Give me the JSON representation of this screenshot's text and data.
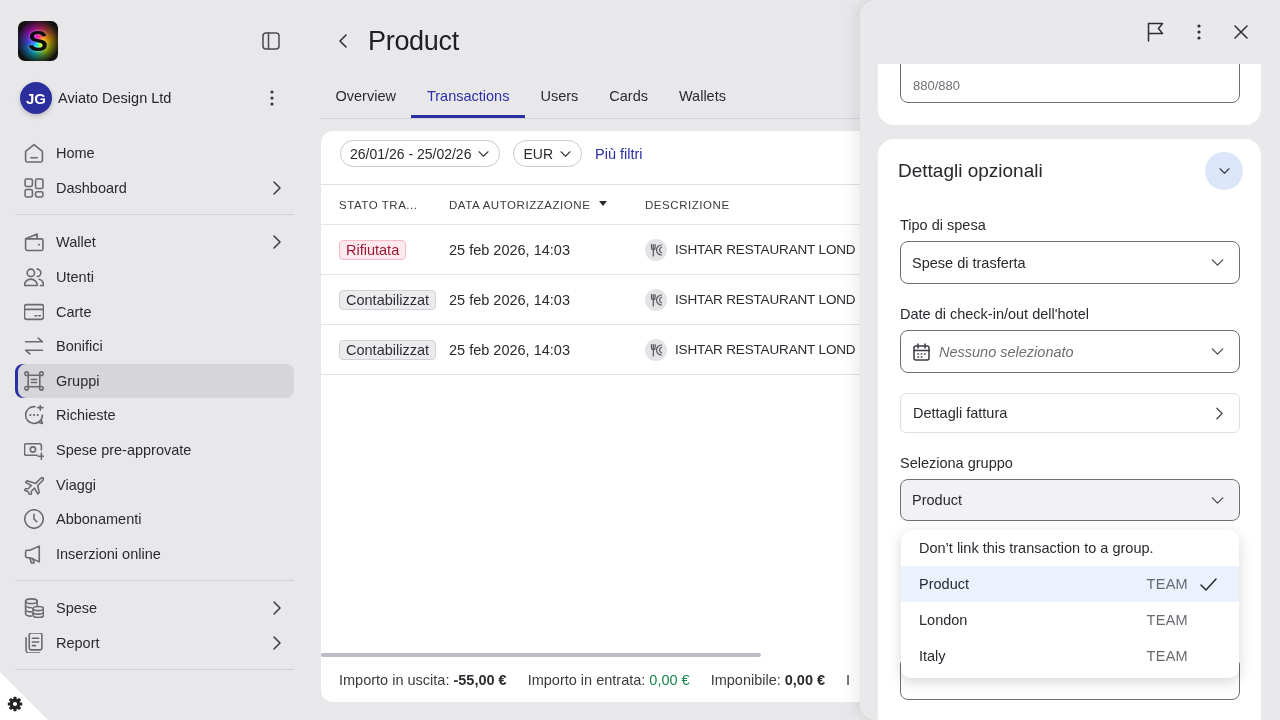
{
  "sidebar": {
    "logo": {
      "letter": "S"
    },
    "account": {
      "initials": "JG",
      "name": "Aviato Design Ltd"
    },
    "sections": [
      {
        "items": [
          {
            "label": "Home",
            "has_submenu": false,
            "selected": false
          },
          {
            "label": "Dashboard",
            "has_submenu": true,
            "selected": false
          }
        ]
      },
      {
        "items": [
          {
            "label": "Wallet",
            "has_submenu": true,
            "selected": false
          },
          {
            "label": "Utenti",
            "has_submenu": false,
            "selected": false
          },
          {
            "label": "Carte",
            "has_submenu": false,
            "selected": false
          },
          {
            "label": "Bonifici",
            "has_submenu": false,
            "selected": false
          },
          {
            "label": "Gruppi",
            "has_submenu": false,
            "selected": true
          },
          {
            "label": "Richieste",
            "has_submenu": false,
            "selected": false
          },
          {
            "label": "Spese pre-approvate",
            "has_submenu": false,
            "selected": false
          },
          {
            "label": "Viaggi",
            "has_submenu": false,
            "selected": false
          },
          {
            "label": "Abbonamenti",
            "has_submenu": false,
            "selected": false
          },
          {
            "label": "Inserzioni online",
            "has_submenu": false,
            "selected": false
          }
        ]
      },
      {
        "items": [
          {
            "label": "Spese",
            "has_submenu": true,
            "selected": false
          },
          {
            "label": "Report",
            "has_submenu": true,
            "selected": false
          }
        ]
      }
    ]
  },
  "page": {
    "title": "Product",
    "tabs": [
      {
        "label": "Overview",
        "selected": false
      },
      {
        "label": "Transactions",
        "selected": true
      },
      {
        "label": "Users",
        "selected": false
      },
      {
        "label": "Cards",
        "selected": false
      },
      {
        "label": "Wallets",
        "selected": false
      }
    ],
    "filters": [
      {
        "kind": "dropdown",
        "label": "26/01/26 - 25/02/26"
      },
      {
        "kind": "dropdown",
        "label": "EUR"
      },
      {
        "kind": "link",
        "label": "Più filtri"
      }
    ],
    "table": {
      "columns": [
        {
          "label": "STATO TRA...",
          "sorted": false
        },
        {
          "label": "DATA AUTORIZZAZIONE",
          "sorted": true
        },
        {
          "label": "DESCRIZIONE",
          "sorted": false
        }
      ],
      "rows": [
        {
          "status": {
            "label": "Rifiutata",
            "kind": "declined"
          },
          "date": "25 feb 2026, 14:03",
          "description": "ISHTAR RESTAURANT LOND"
        },
        {
          "status": {
            "label": "Contabilizzat",
            "kind": "posted"
          },
          "date": "25 feb 2026, 14:03",
          "description": "ISHTAR RESTAURANT LOND"
        },
        {
          "status": {
            "label": "Contabilizzat",
            "kind": "posted"
          },
          "date": "25 feb 2026, 14:03",
          "description": "ISHTAR RESTAURANT LOND"
        }
      ]
    },
    "totals": [
      {
        "label": "Importo in uscita:",
        "value": "-55,00 €",
        "kind": "neutral"
      },
      {
        "label": "Importo in entrata:",
        "value": "0,00 €",
        "kind": "positive"
      },
      {
        "label": "Imponibile:",
        "value": "0,00 €",
        "kind": "neutral"
      },
      {
        "label": "I"
      }
    ]
  },
  "panel": {
    "counter": "880/880",
    "section": {
      "title": "Dettagli opzionali",
      "expanded": true,
      "fields": [
        {
          "kind": "select",
          "label": "Tipo di spesa",
          "value": "Spese di trasferta",
          "open": false
        },
        {
          "kind": "date",
          "label": "Date di check-in/out dell'hotel",
          "placeholder": "Nessuno selezionato"
        },
        {
          "kind": "link",
          "value": "Dettagli fattura"
        },
        {
          "kind": "select",
          "label": "Seleziona gruppo",
          "value": "Product",
          "open": true,
          "options": [
            {
              "label": "Don’t link this transaction to a group.",
              "selected": false
            },
            {
              "label": "Product",
              "tag": "TEAM",
              "selected": true
            },
            {
              "label": "London",
              "tag": "TEAM",
              "selected": false
            },
            {
              "label": "Italy",
              "tag": "TEAM",
              "selected": false
            }
          ]
        },
        {
          "kind": "select"
        }
      ]
    }
  }
}
